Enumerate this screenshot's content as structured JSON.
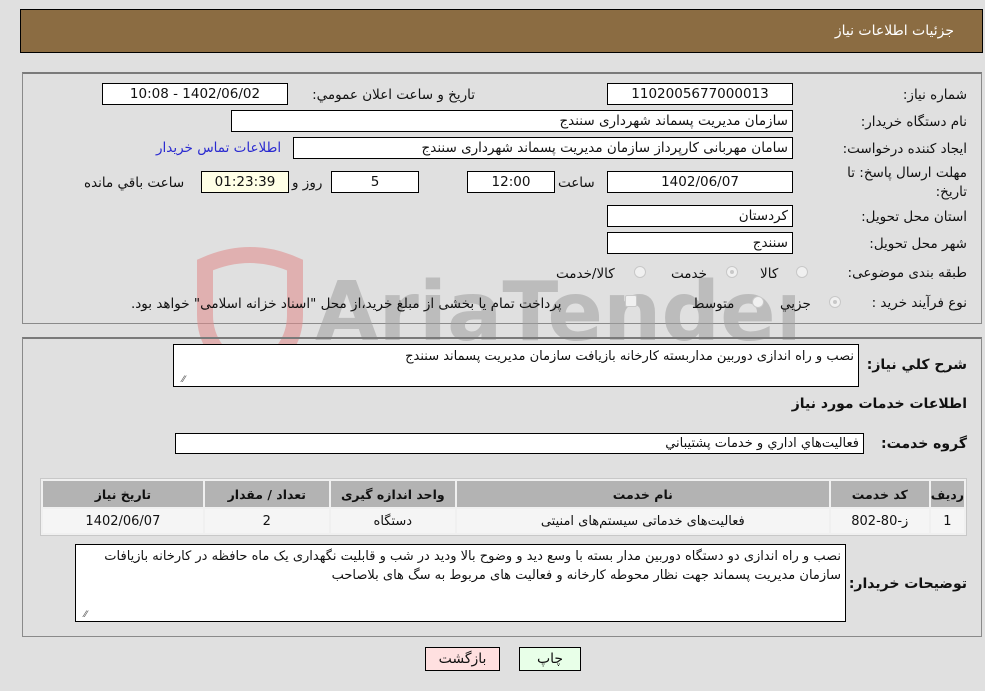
{
  "header": {
    "title": "جزئيات اطلاعات نياز"
  },
  "details": {
    "need_number_label": "شماره نياز:",
    "need_number": "1102005677000013",
    "announce_label": "تاريخ و ساعت اعلان عمومي:",
    "announce_value": "1402/06/02 - 10:08",
    "buyer_org_label": "نام دستگاه خريدار:",
    "buyer_org": "سازمان مدیریت پسماند شهرداری سنندج",
    "requester_label": "ايجاد کننده درخواست:",
    "requester": "سامان مهربانی کارپرداز سازمان مدیریت پسماند شهرداری سنندج",
    "contact_link": "اطلاعات تماس خريدار",
    "deadline_label_line1": "مهلت ارسال پاسخ: تا",
    "deadline_label_line2": "تاريخ:",
    "deadline_date": "1402/06/07",
    "time_label": "ساعت",
    "deadline_time": "12:00",
    "days_value": "5",
    "days_label": "روز و",
    "remaining_time": "01:23:39",
    "remaining_label": "ساعت باقي مانده",
    "province_label": "استان محل تحويل:",
    "province": "کردستان",
    "city_label": "شهر محل تحويل:",
    "city": "سنندج",
    "category_label": "طبقه بندی موضوعی:",
    "category_options": [
      {
        "label": "کالا",
        "selected": false
      },
      {
        "label": "خدمت",
        "selected": true
      },
      {
        "label": "کالا/خدمت",
        "selected": false
      }
    ],
    "process_label": "نوع فرآيند خريد :",
    "process_options": [
      {
        "label": "جزيي",
        "selected": true
      },
      {
        "label": "متوسط",
        "selected": false
      }
    ],
    "treasury_note": "پرداخت تمام يا بخشی از مبلغ خريد،از محل \"اسناد خزانه اسلامی\" خواهد بود.",
    "treasury_checked": false
  },
  "services": {
    "summary_label": "شرح کلي نياز:",
    "summary": "نصب و راه اندازی دوربین مداربسته کارخانه بازیافت سازمان مدیریت پسماند سنندج",
    "section_title": "اطلاعات خدمات مورد نياز",
    "group_label": "گروه خدمت:",
    "group_value": "فعاليت‌هاي اداري و خدمات پشتيباني",
    "table": {
      "headers": [
        "رديف",
        "کد خدمت",
        "نام خدمت",
        "واحد اندازه گيری",
        "تعداد / مقدار",
        "تاريخ نياز"
      ],
      "rows": [
        [
          "1",
          "ز-80-802",
          "فعاليت‌های خدماتی سيستم‌های امنيتی",
          "دستگاه",
          "2",
          "1402/06/07"
        ]
      ]
    },
    "buyer_notes_label": "توضيحات خريدار:",
    "buyer_notes": "نصب و راه اندازی دو دستگاه دوربین مدار بسته با وسع دید و وضوح بالا ودید در شب   و قابلیت نگهداری یک ماه حافظه در کارخانه بازیافات سازمان مدیریت پسماند جهت نظار محوطه کارخانه و فعالیت های مربوط به سگ های بلاصاحب"
  },
  "buttons": {
    "print": "چاپ",
    "back": "بازگشت"
  },
  "watermark": {
    "text": "AriaTender.neT"
  },
  "colors": {
    "header_bg": "#8b6c42",
    "link": "#2a2ad0",
    "back_bg": "#ffe0e0",
    "print_bg": "#e8ffe8",
    "timer_bg": "#ffffe6"
  }
}
